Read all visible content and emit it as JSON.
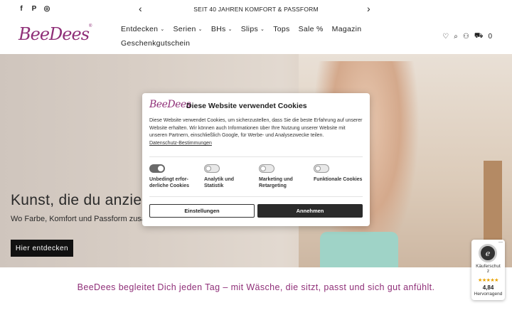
{
  "topbar": {
    "social": [
      "f",
      "P",
      "◎"
    ],
    "social_names": [
      "facebook-icon",
      "pinterest-icon",
      "instagram-icon"
    ],
    "announcement": "SEIT 40 JAHREN KOMFORT & PASSFORM",
    "prev_arrow": "‹",
    "next_arrow": "›"
  },
  "header": {
    "logo_text": "BeeDees",
    "logo_reg": "®",
    "nav": [
      {
        "label": "Entdecken",
        "has_dropdown": true
      },
      {
        "label": "Serien",
        "has_dropdown": true
      },
      {
        "label": "BHs",
        "has_dropdown": true
      },
      {
        "label": "Slips",
        "has_dropdown": true
      },
      {
        "label": "Tops",
        "has_dropdown": false
      },
      {
        "label": "Sale %",
        "has_dropdown": false
      },
      {
        "label": "Magazin",
        "has_dropdown": false
      },
      {
        "label": "Geschenkgutschein",
        "has_dropdown": false
      }
    ],
    "chevron": "⌄",
    "icons": {
      "wishlist": "♡",
      "search": "⌕",
      "account": "⚇",
      "cart": "⛟",
      "cart_count": "0"
    }
  },
  "hero": {
    "title": "Kunst, die du anzieh",
    "subtitle": "Wo Farbe, Komfort und Passform zusa",
    "button": "Hier entdecken"
  },
  "tagline": "BeeDees begleitet Dich jeden Tag – mit Wäsche, die sitzt, passt und sich gut anfühlt.",
  "cookie": {
    "logo": "BeeDees",
    "title": "Diese Website verwendet Cookies",
    "text": "Diese Website verwendet Cookies, um sicherzustellen, dass Sie die beste Erfahrung auf unserer Website erhalten. Wir können auch Informationen über Ihre Nutzung unserer Website mit unseren Partnern, einschließlich Google, für Werbe- und Analysezwecke teilen.",
    "link": "Datenschutz-Bestimmungen",
    "toggles": [
      {
        "label": "Unbedingt erfor-\nderliche Cookies",
        "on": true
      },
      {
        "label": "Analytik und\nStatistik",
        "on": false
      },
      {
        "label": "Marketing und\nRetargeting",
        "on": false
      },
      {
        "label": "Funktionale Cookies",
        "on": false
      }
    ],
    "settings_button": "Einstellungen",
    "accept_button": "Annehmen"
  },
  "badge": {
    "close": "—",
    "seal": "e",
    "label": "Käuferschut\nz",
    "stars": "★★★★★",
    "score": "4,84",
    "rating": "Hervorragend"
  },
  "colors": {
    "brand": "#8f2f78",
    "button_dark": "#111111",
    "stars": "#e8a200"
  }
}
